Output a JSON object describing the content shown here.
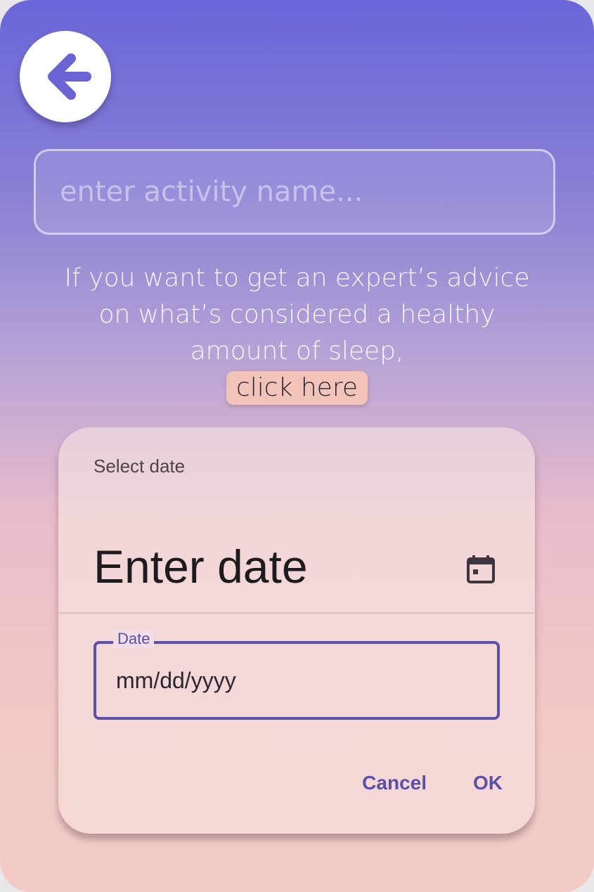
{
  "back_button": {
    "icon": "arrow-left-icon",
    "color": "#6a63d4"
  },
  "activity": {
    "placeholder": "enter activity name..."
  },
  "advice": {
    "text": "If you want to get an expert’s advice on what’s considered a healthy amount of sleep,",
    "link_label": "click here"
  },
  "date_dialog": {
    "header_label": "Select date",
    "title": "Enter date",
    "calendar_icon": "calendar-icon",
    "field_label": "Date",
    "field_placeholder": "mm/dd/yyyy",
    "cancel_label": "Cancel",
    "ok_label": "OK"
  },
  "colors": {
    "accent": "#5c4fa8",
    "link_bg": "#f2c4b9"
  }
}
